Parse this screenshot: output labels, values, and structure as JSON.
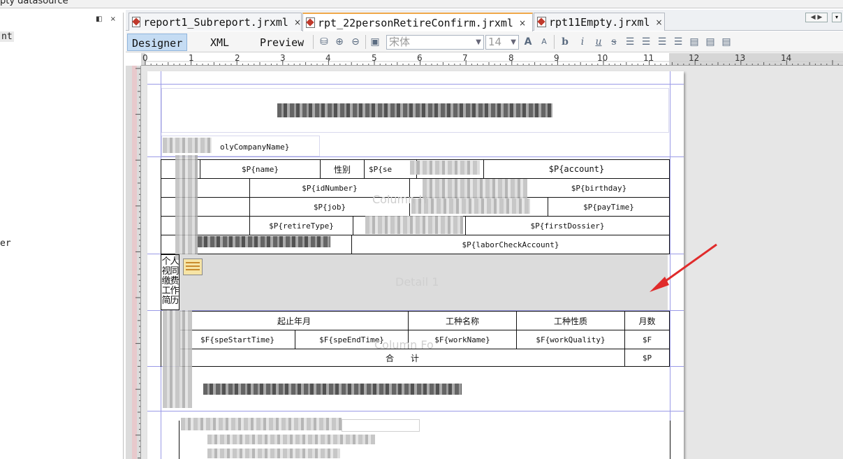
{
  "top_strip": {
    "text": "pty datasource"
  },
  "left_panel": {
    "controls": "◧ ×",
    "items": [
      {
        "label": "nt"
      },
      {
        "label": "er"
      }
    ]
  },
  "tabs": [
    {
      "label": "report1_Subreport.jrxml",
      "close": "×",
      "active": false
    },
    {
      "label": "rpt_22personRetireConfirm.jrxml",
      "close": "×",
      "active": true
    },
    {
      "label": "rpt11Empty.jrxml",
      "close": "×",
      "active": false
    }
  ],
  "nav": {
    "arrows": "◀ ▶",
    "menu": "▾"
  },
  "view_modes": [
    {
      "label": "Designer",
      "active": true
    },
    {
      "label": "XML",
      "active": false
    },
    {
      "label": "Preview",
      "active": false
    }
  ],
  "toolbar": {
    "font_name": "宋体",
    "font_size": "14",
    "icons": [
      "database-icon",
      "zoom-in-icon",
      "zoom-out-icon",
      "format-icon",
      "increase-font-icon",
      "decrease-font-icon",
      "bold-icon",
      "italic-icon",
      "underline-icon",
      "strikethrough-icon",
      "align-left-icon",
      "align-justify-icon",
      "align-center-icon",
      "align-right-icon",
      "align-top-icon",
      "align-middle-icon",
      "align-bottom-icon"
    ],
    "icon_glyphs": {
      "bold": "b",
      "italic": "i",
      "underline": "u",
      "strike": "s"
    }
  },
  "ruler": {
    "ticks": [
      "0",
      "1",
      "2",
      "3",
      "4",
      "5",
      "6",
      "7",
      "8",
      "9",
      "10",
      "11",
      "12",
      "13",
      "14"
    ]
  },
  "report": {
    "company_field": "olyCompanyName}",
    "row1": {
      "name": "$P{name}",
      "sex_label": "性别",
      "sex_field": "$P{se",
      "account": "$P{account}"
    },
    "row2": {
      "id": "$P{idNumber}",
      "birthday": "$P{birthday}"
    },
    "row3": {
      "job": "$P{job}",
      "pay": "$P{payTime}"
    },
    "row4": {
      "retire": "$P{retireType}",
      "dossier": "$P{firstDossier}"
    },
    "row5": {
      "labor": "$P{laborCheckAccount}"
    },
    "column_header_label": "Column H",
    "detail_label": "Detail 1",
    "side_label": "个人视同缴费工作简历",
    "side_chars": [
      "个",
      "人",
      "视",
      "同",
      "缴",
      "费",
      "工",
      "作",
      "简",
      "历"
    ],
    "work_headers": {
      "period": "起止年月",
      "work_name": "工种名称",
      "work_quality": "工种性质",
      "months": "月数"
    },
    "work_row": {
      "start": "$F{speStartTime}",
      "end": "$F{speEndTime}",
      "work_name": "$F{workName}",
      "work_quality": "$F{workQuality}",
      "months": "$F"
    },
    "column_footer_label": "Column Fo",
    "total_label": "合　　计",
    "total_field": "$P"
  },
  "colors": {
    "accent": "#f0a94a",
    "band_line": "#9a9ae6",
    "detail_bg": "#dcdcdc",
    "arrow": "#e02b2b"
  }
}
